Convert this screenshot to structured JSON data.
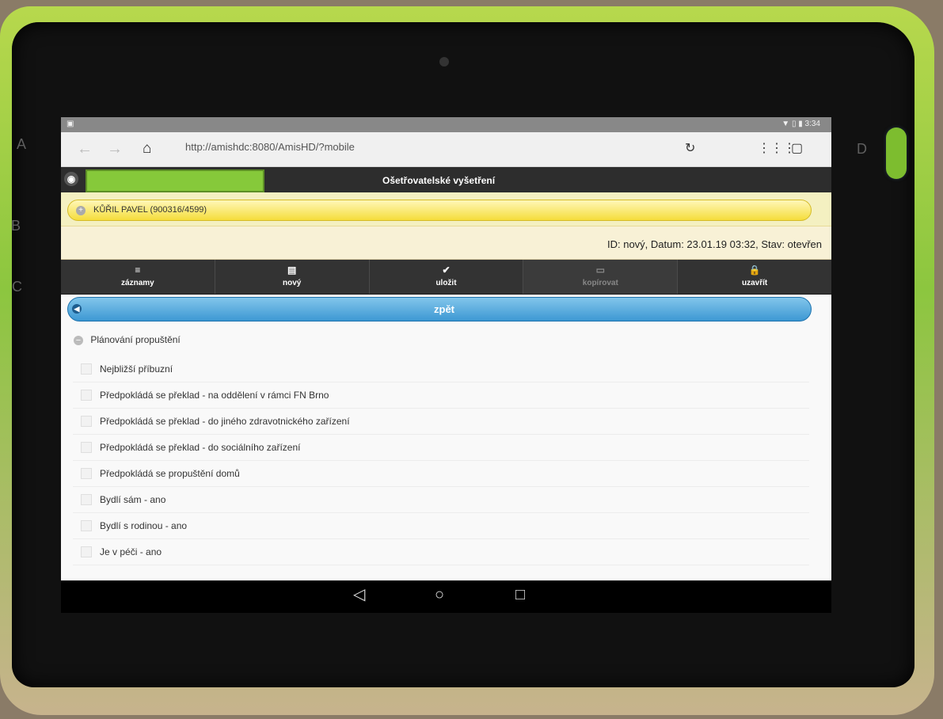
{
  "frame": {
    "letters": [
      "A",
      "B",
      "C",
      "D"
    ]
  },
  "status": {
    "right": "▼ ▯ ▮ 3:34"
  },
  "browser": {
    "url": "http://amishdc:8080/AmisHD/?mobile"
  },
  "app": {
    "title": "Ošetřovatelské vyšetření",
    "patient": "KŮŘIL PAVEL (900316/4599)",
    "info": "ID: nový, Datum: 23.01.19 03:32, Stav: otevřen"
  },
  "toolbar": {
    "items": [
      {
        "label": "záznamy"
      },
      {
        "label": "nový"
      },
      {
        "label": "uložit"
      },
      {
        "label": "kopírovat"
      },
      {
        "label": "uzavřít"
      }
    ]
  },
  "content": {
    "back": "zpět",
    "section": "Plánování propuštění",
    "items": [
      "Nejbližší příbuzní",
      "Předpokládá se překlad - na oddělení v rámci FN Brno",
      "Předpokládá se překlad - do jiného zdravotnického zařízení",
      "Předpokládá se překlad - do sociálního zařízení",
      "Předpokládá se propuštění domů",
      "Bydlí sám - ano",
      "Bydlí s rodinou - ano",
      "Je v péči - ano"
    ]
  }
}
